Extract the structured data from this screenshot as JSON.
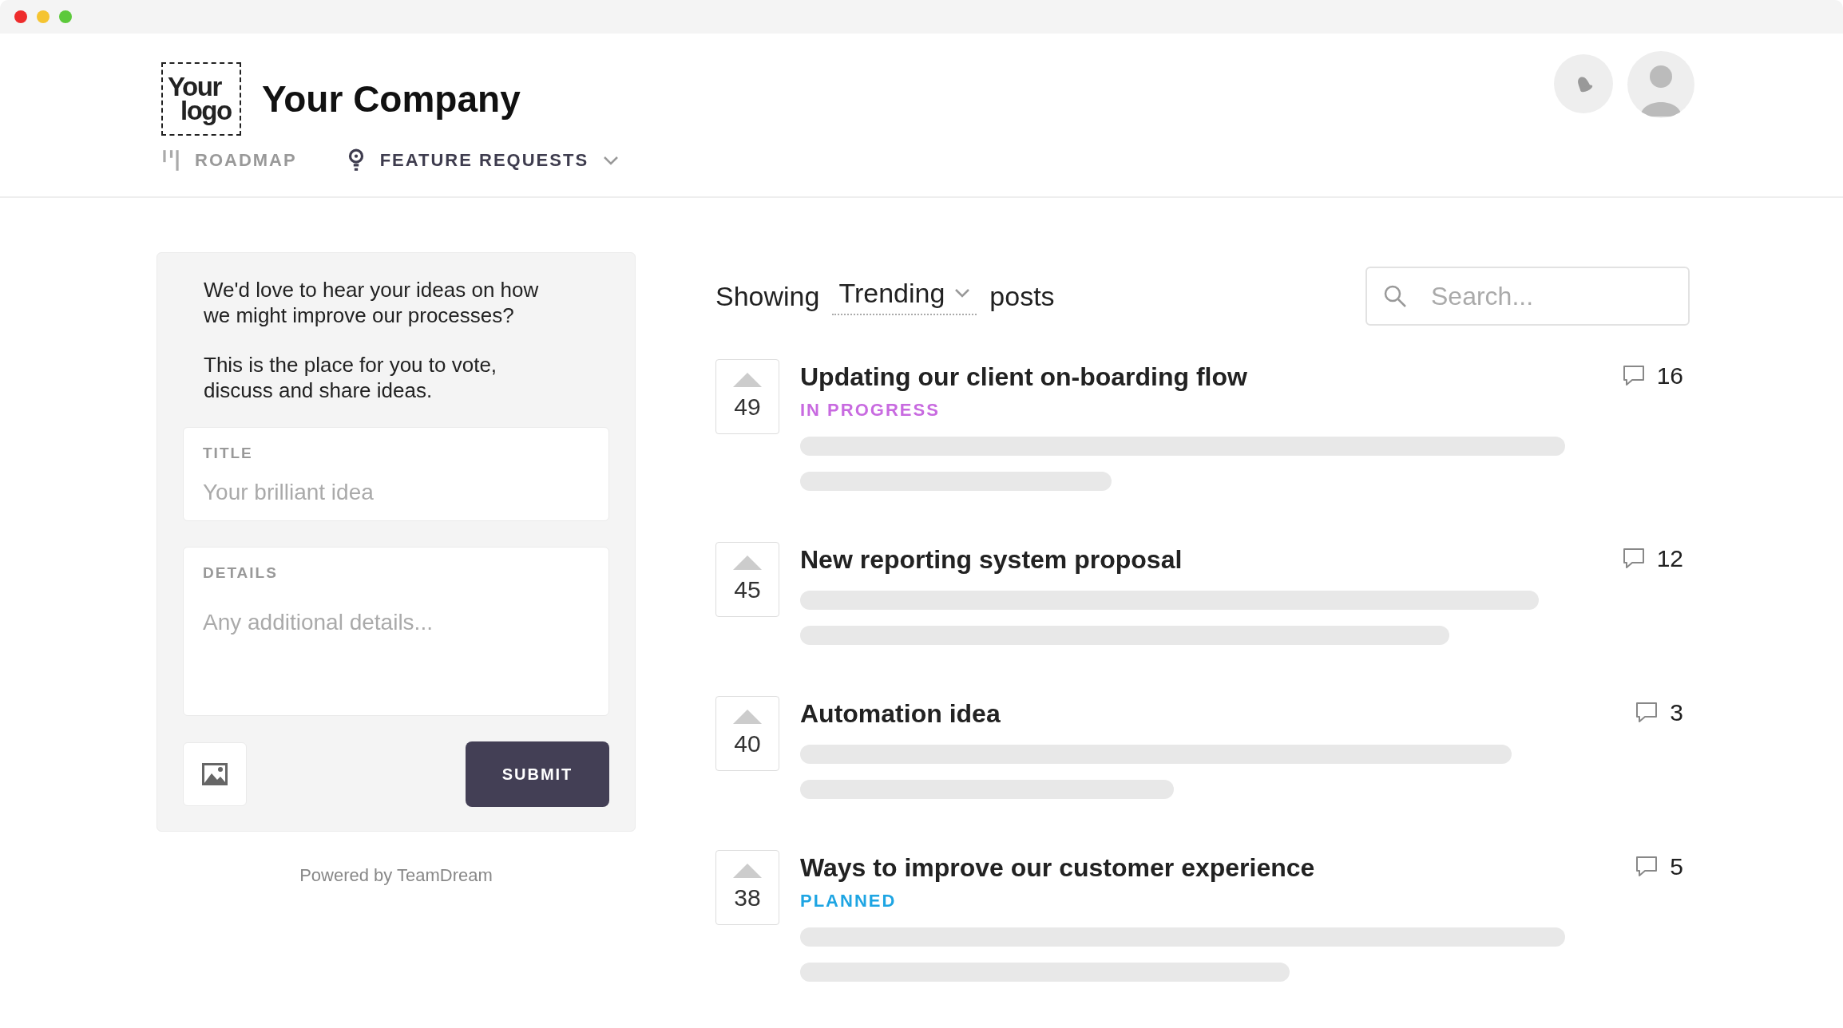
{
  "header": {
    "logo": [
      "Your",
      "logo"
    ],
    "company": "Your Company",
    "nav": [
      {
        "label": "ROADMAP",
        "selected": false,
        "dropdown": false
      },
      {
        "label": "FEATURE REQUESTS",
        "selected": true,
        "dropdown": true
      }
    ]
  },
  "intro": [
    "We'd  love to hear your ideas on how we might improve our processes?",
    "This is the place for you to vote, discuss and share ideas."
  ],
  "form": {
    "title_label": "TITLE",
    "title_placeholder": "Your brilliant idea",
    "details_label": "DETAILS",
    "details_placeholder": "Any additional details...",
    "submit": "SUBMIT"
  },
  "powered_by": "Powered by TeamDream",
  "filter": {
    "prefix": "Showing",
    "sort": "Trending",
    "suffix": "posts"
  },
  "search": {
    "placeholder": "Search..."
  },
  "posts": [
    {
      "votes": "49",
      "title": "Updating our client on-boarding flow",
      "status": {
        "label": "IN PROGRESS",
        "color": "#c86ae0"
      },
      "comments": "16"
    },
    {
      "votes": "45",
      "title": "New reporting system proposal",
      "comments": "12"
    },
    {
      "votes": "40",
      "title": "Automation idea",
      "comments": "3"
    },
    {
      "votes": "38",
      "title": "Ways to improve our customer experience",
      "status": {
        "label": "PLANNED",
        "color": "#1ea5e3"
      },
      "comments": "5"
    }
  ]
}
